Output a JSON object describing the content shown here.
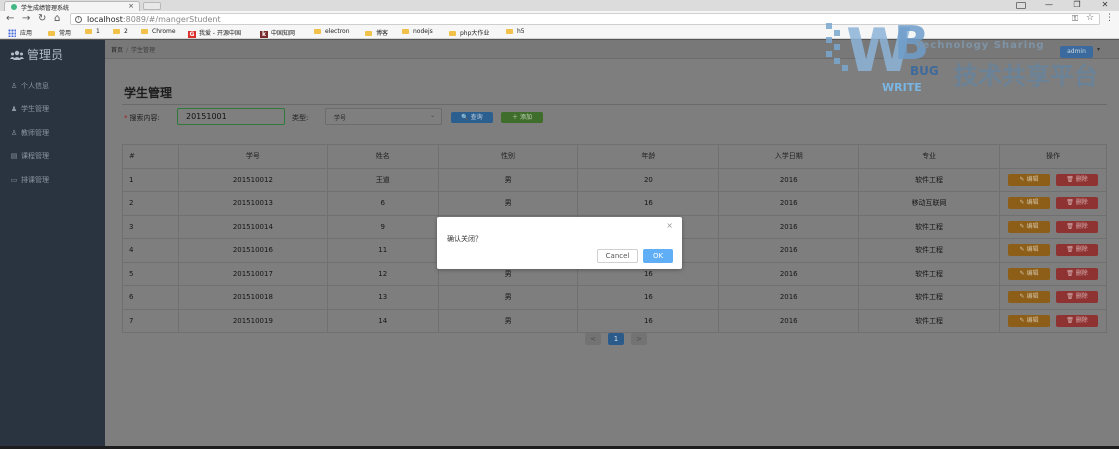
{
  "browser": {
    "tab_title": "学生成绩管理系统",
    "tab_close": "×",
    "url_host": "localhost",
    "url_path": ":8089/#/mangerStudent",
    "window_controls": [
      "—",
      "❐",
      "✕"
    ],
    "bookmarks": [
      {
        "label": "应用",
        "icon": "apps-icon"
      },
      {
        "label": "常用",
        "icon": "folder-icon"
      },
      {
        "label": "1",
        "icon": "folder-icon"
      },
      {
        "label": "2",
        "icon": "folder-icon"
      },
      {
        "label": "Chrome",
        "icon": "folder-icon"
      },
      {
        "label": "我爱 - 开源中国",
        "icon": "g-icon"
      },
      {
        "label": "中国知网",
        "icon": "cnki-icon"
      },
      {
        "label": "electron",
        "icon": "folder-icon"
      },
      {
        "label": "博客",
        "icon": "folder-icon"
      },
      {
        "label": "nodejs",
        "icon": "folder-icon"
      },
      {
        "label": "php大作业",
        "icon": "folder-icon"
      },
      {
        "label": "h5",
        "icon": "folder-icon"
      }
    ]
  },
  "sidebar": {
    "brand": "管理员",
    "items": [
      {
        "label": "个人信息",
        "icon": "person-icon"
      },
      {
        "label": "学生管理",
        "icon": "student-icon"
      },
      {
        "label": "教师管理",
        "icon": "teacher-icon"
      },
      {
        "label": "课程管理",
        "icon": "course-icon"
      },
      {
        "label": "排课管理",
        "icon": "schedule-icon"
      }
    ]
  },
  "header": {
    "breadcrumb_home": "首页",
    "breadcrumb_sep": "/",
    "breadcrumb_current": "学生管理",
    "admin_label": "admin",
    "admin_caret": "▾"
  },
  "page": {
    "title": "学生管理",
    "search_label": "搜索内容:",
    "search_required_mark": "*",
    "search_value": "20151001",
    "type_label": "类型:",
    "type_selected": "学号",
    "query_label": "🔍 查询",
    "add_label": "＋ 添加"
  },
  "table": {
    "headers": [
      "#",
      "学号",
      "姓名",
      "性别",
      "年龄",
      "入学日期",
      "专业",
      "操作"
    ],
    "rows": [
      [
        "1",
        "201510012",
        "王道",
        "男",
        "20",
        "2016",
        "软件工程"
      ],
      [
        "2",
        "201510013",
        "6",
        "男",
        "16",
        "2016",
        "移动互联网"
      ],
      [
        "3",
        "201510014",
        "9",
        "",
        "",
        "2016",
        "软件工程"
      ],
      [
        "4",
        "201510016",
        "11",
        "",
        "",
        "2016",
        "软件工程"
      ],
      [
        "5",
        "201510017",
        "12",
        "男",
        "16",
        "2016",
        "软件工程"
      ],
      [
        "6",
        "201510018",
        "13",
        "男",
        "16",
        "2016",
        "软件工程"
      ],
      [
        "7",
        "201510019",
        "14",
        "男",
        "16",
        "2016",
        "软件工程"
      ]
    ],
    "edit_label": "✎ 编辑",
    "delete_label": "🗑 删除"
  },
  "pagination": {
    "prev": "<",
    "current": "1",
    "next": ">"
  },
  "modal": {
    "message": "确认关闭？",
    "close": "×",
    "cancel_label": "Cancel",
    "ok_label": "OK"
  },
  "watermark": {
    "en": "Technology Sharing",
    "cn": "技术共享平台"
  },
  "colors": {
    "sidebar_bg": "#2a3340",
    "primary": "#409eff",
    "success": "#67c23a",
    "warning": "#e6a23c",
    "danger": "#f56c6c"
  }
}
